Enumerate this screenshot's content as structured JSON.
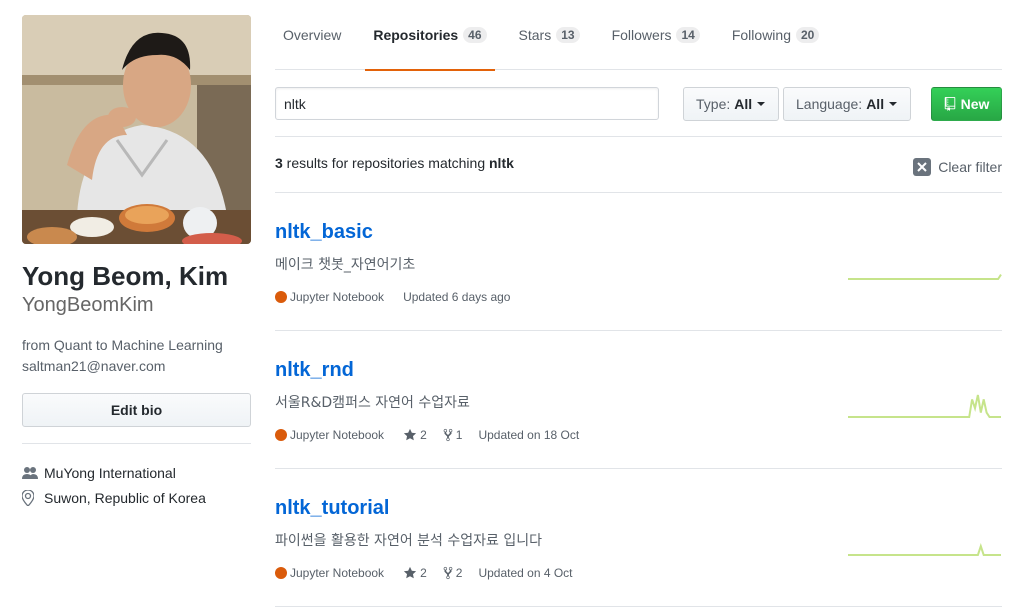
{
  "profile": {
    "fullname": "Yong Beom, Kim",
    "username": "YongBeomKim",
    "bio": "from Quant to Machine Learning",
    "email": "saltman21@naver.com",
    "edit_bio_label": "Edit bio",
    "organization": "MuYong International",
    "location": "Suwon, Republic of Korea"
  },
  "tabs": [
    {
      "label": "Overview",
      "count": null,
      "selected": false
    },
    {
      "label": "Repositories",
      "count": "46",
      "selected": true
    },
    {
      "label": "Stars",
      "count": "13",
      "selected": false
    },
    {
      "label": "Followers",
      "count": "14",
      "selected": false
    },
    {
      "label": "Following",
      "count": "20",
      "selected": false
    }
  ],
  "filter": {
    "search_value": "nltk",
    "type_label": "Type:",
    "type_value": "All",
    "language_label": "Language:",
    "language_value": "All",
    "new_button_label": "New"
  },
  "results": {
    "count": "3",
    "text": " results for repositories matching ",
    "query": "nltk",
    "clear_label": "Clear filter"
  },
  "repos": [
    {
      "name": "nltk_basic",
      "description": "메이크 챗봇_자연어기초",
      "language": "Jupyter Notebook",
      "language_color": "#DA5B0B",
      "stars": null,
      "forks": null,
      "updated": "Updated 6 days ago",
      "activity": [
        0,
        0,
        0,
        0,
        0,
        0,
        0,
        0,
        0,
        0,
        0,
        0,
        0,
        0,
        0,
        0,
        0,
        0,
        0,
        0,
        0,
        0,
        0,
        0,
        0,
        0,
        0,
        0,
        0,
        0,
        0,
        0,
        0,
        0,
        0,
        0,
        0,
        0,
        0,
        0,
        0,
        0,
        0,
        0,
        0,
        0,
        0,
        0,
        0,
        0,
        0,
        0,
        0,
        1
      ]
    },
    {
      "name": "nltk_rnd",
      "description": "서울R&D캠퍼스 자연어 수업자료",
      "language": "Jupyter Notebook",
      "language_color": "#DA5B0B",
      "stars": "2",
      "forks": "1",
      "updated": "Updated on 18 Oct",
      "activity": [
        0,
        0,
        0,
        0,
        0,
        0,
        0,
        0,
        0,
        0,
        0,
        0,
        0,
        0,
        0,
        0,
        0,
        0,
        0,
        0,
        0,
        0,
        0,
        0,
        0,
        0,
        0,
        0,
        0,
        0,
        0,
        0,
        0,
        0,
        0,
        0,
        0,
        0,
        0,
        0,
        0,
        0,
        0,
        4,
        2,
        5,
        1,
        4,
        1,
        0,
        0,
        0,
        0,
        0
      ]
    },
    {
      "name": "nltk_tutorial",
      "description": "파이썬을 활용한 자연어 분석 수업자료 입니다",
      "language": "Jupyter Notebook",
      "language_color": "#DA5B0B",
      "stars": "2",
      "forks": "2",
      "updated": "Updated on 4 Oct",
      "activity": [
        0,
        0,
        0,
        0,
        0,
        0,
        0,
        0,
        0,
        0,
        0,
        0,
        0,
        0,
        0,
        0,
        0,
        0,
        0,
        0,
        0,
        0,
        0,
        0,
        0,
        0,
        0,
        0,
        0,
        0,
        0,
        0,
        0,
        0,
        0,
        0,
        0,
        0,
        0,
        0,
        0,
        0,
        0,
        0,
        0,
        0,
        2,
        0,
        0,
        0,
        0,
        0,
        0,
        0
      ]
    }
  ]
}
